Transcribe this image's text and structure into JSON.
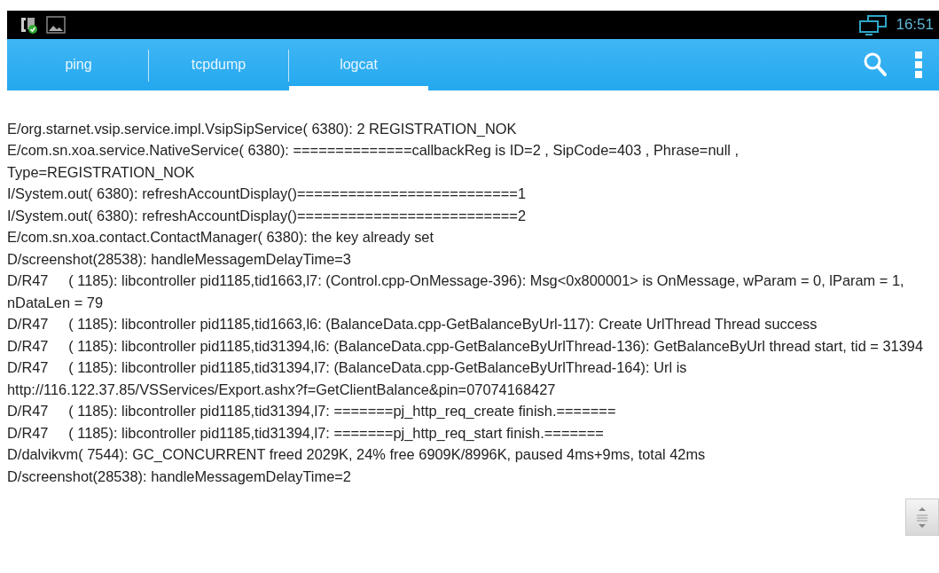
{
  "status_bar": {
    "time": "16:51"
  },
  "tabs": [
    {
      "label": "ping",
      "selected": false
    },
    {
      "label": "tcpdump",
      "selected": false
    },
    {
      "label": "logcat",
      "selected": true
    }
  ],
  "log": [
    "E/org.starnet.vsip.service.impl.VsipSipService( 6380): 2 REGISTRATION_NOK",
    "E/com.sn.xoa.service.NativeService( 6380): ==============callbackReg is ID=2 , SipCode=403 , Phrase=null , Type=REGISTRATION_NOK",
    "I/System.out( 6380): refreshAccountDisplay()==========================1",
    "I/System.out( 6380): refreshAccountDisplay()==========================2",
    "E/com.sn.xoa.contact.ContactManager( 6380): the key already set",
    "D/screenshot(28538): handleMessagemDelayTime=3",
    "D/R47     ( 1185): libcontroller pid1185,tid1663,l7: (Control.cpp-OnMessage-396): Msg<0x800001> is OnMessage, wParam = 0, lParam = 1, nDataLen = 79",
    "D/R47     ( 1185): libcontroller pid1185,tid1663,l6: (BalanceData.cpp-GetBalanceByUrl-117): Create UrlThread Thread success",
    "D/R47     ( 1185): libcontroller pid1185,tid31394,l6: (BalanceData.cpp-GetBalanceByUrlThread-136): GetBalanceByUrl thread start, tid = 31394",
    "D/R47     ( 1185): libcontroller pid1185,tid31394,l7: (BalanceData.cpp-GetBalanceByUrlThread-164): Url is http://116.122.37.85/VSServices/Export.ashx?f=GetClientBalance&pin=07074168427",
    "D/R47     ( 1185): libcontroller pid1185,tid31394,l7: =======pj_http_req_create finish.=======",
    "D/R47     ( 1185): libcontroller pid1185,tid31394,l7: =======pj_http_req_start finish.=======",
    "D/dalvikvm( 7544): GC_CONCURRENT freed 2029K, 24% free 6909K/8996K, paused 4ms+9ms, total 42ms",
    "D/screenshot(28538): handleMessagemDelayTime=2"
  ]
}
